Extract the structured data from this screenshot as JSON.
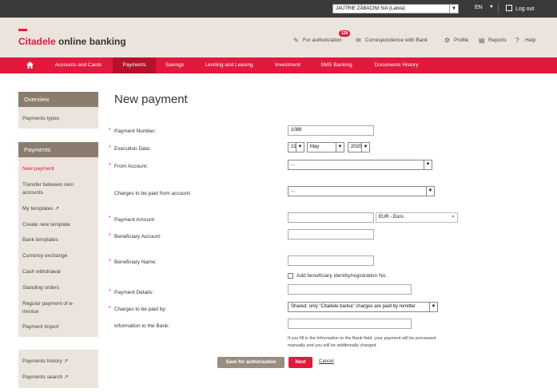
{
  "topbar": {
    "company": "JAUTRIE ZĀBACIŅI SIA (Latvia)",
    "language": "EN",
    "logout": "Log out"
  },
  "header": {
    "logo_brand": "Citadele",
    "logo_rest": " online banking",
    "for_authorization": "For authorization",
    "auth_count": "128",
    "correspondence": "Correspondence with Bank",
    "profile": "Profile",
    "reports": "Reports",
    "help": "Help"
  },
  "nav": {
    "items": [
      "Accounts and Cards",
      "Payments",
      "Savings",
      "Lending and Leasing",
      "Investment",
      "SMS Banking",
      "Documents History"
    ],
    "active": "Payments"
  },
  "sidebar": {
    "overview_title": "Overview",
    "overview_items": [
      "Payments types"
    ],
    "payments_title": "Payments",
    "payments_items": [
      "New payment",
      "Transfer between own accounts",
      "My templates ↗",
      "Create new template",
      "Bank templates",
      "Currency exchange",
      "Cash withdrawal",
      "Standing orders",
      "Regular payment of e-invoice",
      "Payment import"
    ],
    "bottom_items": [
      "Payments history ↗",
      "Payments search ↗"
    ]
  },
  "form": {
    "title": "New payment",
    "payment_number_label": "Payment Number:",
    "payment_number_value": "1088",
    "execution_date_label": "Execution Date:",
    "day": "21",
    "month": "May",
    "year": "2020",
    "from_account_label": "From Account:",
    "from_account_value": "...",
    "charges_from_label": "Charges to be paid from account:",
    "charges_from_value": "...",
    "amount_label": "Payment Amount:",
    "amount_value": "",
    "currency": "EUR - Euro",
    "beneficiary_account_label": "Beneficiary Account:",
    "beneficiary_name_label": "Beneficiary Name:",
    "add_identity_label": "Add beneficiary identity/registration No.",
    "details_label": "Payment Details:",
    "charges_by_label": "Charges to be paid by:",
    "charges_by_value": "Shared: only \"Citadele banka\" charges are paid by remitter",
    "info_label": "Information to the Bank:",
    "note": "If you fill in the Information to the Bank field, your payment will be processed manually and you will be additionally charged.",
    "save_button": "Save for authorization",
    "next_button": "Next",
    "cancel": "Cancel"
  },
  "colors": {
    "brand_red": "#e3183d",
    "nav_active": "#b5112c",
    "sidebar_head": "#8b7d6e",
    "beige": "#ebe4dd"
  }
}
